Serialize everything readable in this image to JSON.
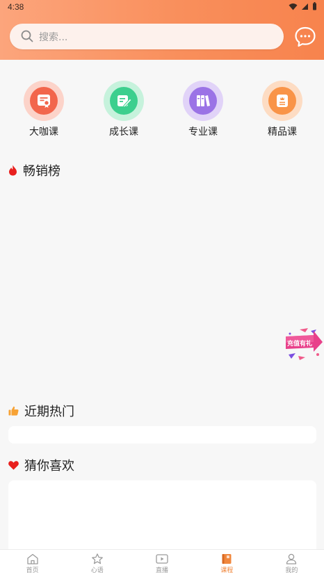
{
  "status": {
    "time": "4:38"
  },
  "search": {
    "placeholder": "搜索..."
  },
  "categories": [
    {
      "label": "大咖课",
      "icon": "certificate-icon",
      "color": "#f2664c",
      "ring": "#fbc9bd"
    },
    {
      "label": "成长课",
      "icon": "note-edit-icon",
      "color": "#3ccf8e",
      "ring": "#bdf0d8"
    },
    {
      "label": "专业课",
      "icon": "books-icon",
      "color": "#9b73e6",
      "ring": "#dccdf7"
    },
    {
      "label": "精品课",
      "icon": "premium-book-icon",
      "color": "#f99448",
      "ring": "#fcd6b8"
    }
  ],
  "sections": {
    "bestseller": "畅销榜",
    "recent_hot": "近期热门",
    "guess_like": "猜你喜欢"
  },
  "recharge": {
    "label": "充值有礼"
  },
  "nav": [
    {
      "label": "首页",
      "icon": "home-icon",
      "active": false
    },
    {
      "label": "心语",
      "icon": "star-icon",
      "active": false
    },
    {
      "label": "直播",
      "icon": "live-video-icon",
      "active": false
    },
    {
      "label": "课程",
      "icon": "course-book-icon",
      "active": true
    },
    {
      "label": "我的",
      "icon": "profile-icon",
      "active": false
    }
  ],
  "colors": {
    "accent": "#f7834d",
    "nav_active": "#f0873d"
  }
}
